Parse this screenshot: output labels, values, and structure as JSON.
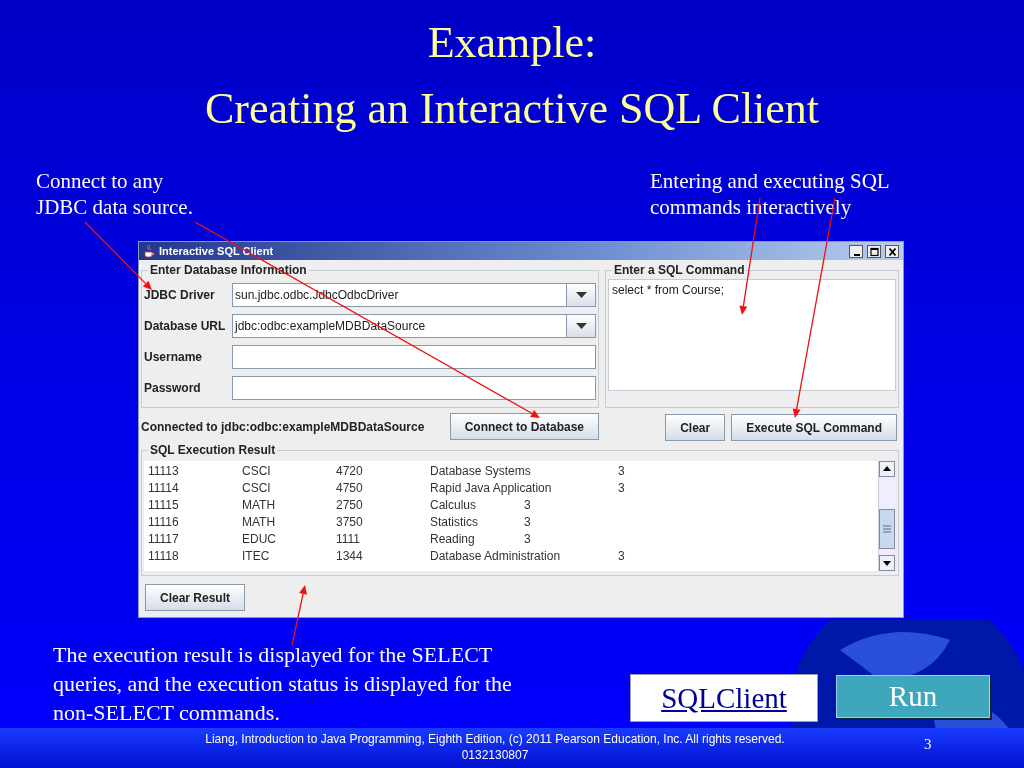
{
  "slide": {
    "title_lines": [
      "Example:",
      "Creating an Interactive SQL Client"
    ],
    "callouts": [
      "Connect to any JDBC data source.",
      "Entering and executing SQL commands interactively"
    ],
    "note": "The execution result is displayed for the SELECT queries, and the execution status is displayed for the non-SELECT commands.",
    "buttons": [
      {
        "label": "SQLClient",
        "kind": "link"
      },
      {
        "label": "Run",
        "kind": "button"
      }
    ],
    "footer": "Liang, Introduction to Java Programming, Eighth Edition, (c) 2011 Pearson Education, Inc. All rights reserved. 0132130807",
    "page_number": "3"
  },
  "window": {
    "title": "Interactive SQL Client",
    "database_panel": {
      "legend": "Enter Database Information",
      "fields": [
        {
          "label": "JDBC Driver",
          "value": "sun.jdbc.odbc.JdbcOdbcDriver",
          "kind": "combo"
        },
        {
          "label": "Database URL",
          "value": "jdbc:odbc:exampleMDBDataSource",
          "kind": "combo"
        },
        {
          "label": "Username",
          "kind": "text"
        },
        {
          "label": "Password",
          "kind": "text"
        }
      ]
    },
    "status": "Connected to jdbc:odbc:exampleMDBDataSource",
    "connect_button": "Connect to Database",
    "command_panel": {
      "legend": "Enter a SQL Command",
      "value": "select * from Course;"
    },
    "command_buttons": [
      "Clear",
      "Execute SQL Command"
    ],
    "result_panel": {
      "legend": "SQL Execution Result",
      "rows": [
        [
          "11113",
          "CSCI",
          "4720",
          "Database Systems",
          "3"
        ],
        [
          "11114",
          "CSCI",
          "4750",
          "Rapid Java Application",
          "3"
        ],
        [
          "11115",
          "MATH",
          "2750",
          "Calculus",
          "3"
        ],
        [
          "11116",
          "MATH",
          "3750",
          "Statistics",
          "3"
        ],
        [
          "11117",
          "EDUC",
          "1111",
          "Reading",
          "3"
        ],
        [
          "11118",
          "ITEC",
          "1344",
          "Database Administration",
          "3"
        ]
      ]
    },
    "clear_result_button": "Clear Result"
  }
}
